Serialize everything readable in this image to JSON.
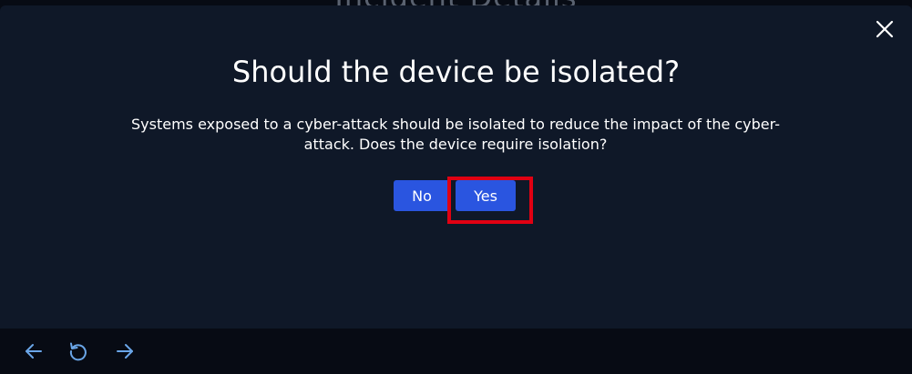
{
  "background": {
    "title": "Incident Details"
  },
  "dialog": {
    "title": "Should the device be isolated?",
    "body": "Systems exposed to a cyber-attack should be isolated to reduce the impact of the cyber-attack. Does the device require isolation?",
    "no_label": "No",
    "yes_label": "Yes",
    "close_icon": "close-icon"
  },
  "footer": {
    "icons": [
      "arrow-left-icon",
      "reload-icon",
      "arrow-right-icon"
    ]
  },
  "colors": {
    "modal_bg": "#0f1828",
    "page_bg": "#070b14",
    "button": "#2a55e0",
    "highlight": "#e10012",
    "nav_icon": "#6aa6e8"
  }
}
